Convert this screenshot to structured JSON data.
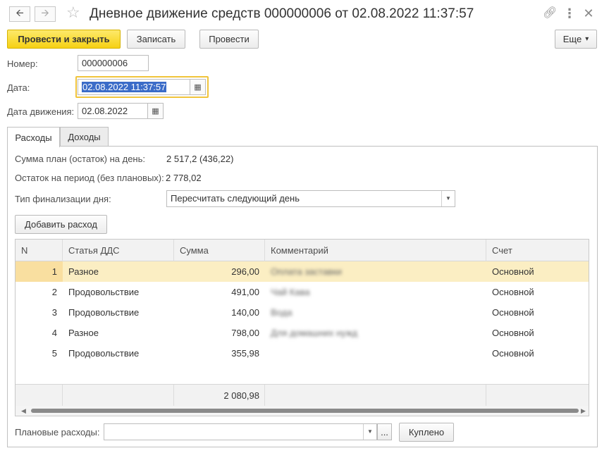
{
  "window": {
    "title": "Дневное движение средств 000000006 от 02.08.2022 11:37:57",
    "back_icon": "arrow-left-icon",
    "forward_icon": "arrow-right-icon",
    "favorite_icon": "star-icon",
    "link_icon": "link-icon",
    "menu_icon": "more-vertical-icon",
    "close_icon": "close-icon"
  },
  "toolbar": {
    "post_close": "Провести и закрыть",
    "save": "Записать",
    "post": "Провести",
    "more": "Еще",
    "more_arrow": "▾"
  },
  "form": {
    "number_label": "Номер:",
    "number_value": "000000006",
    "date_label": "Дата:",
    "date_value": "02.08.2022 11:37:57",
    "move_date_label": "Дата движения:",
    "move_date_value": "02.08.2022"
  },
  "tabs": [
    "Расходы",
    "Доходы"
  ],
  "summary": {
    "plan_label": "Сумма план (остаток) на день:",
    "plan_value": "2 517,2 (436,22)",
    "balance_label": "Остаток на период (без плановых):",
    "balance_value": "2 778,02",
    "finalization_label": "Тип финализации дня:",
    "finalization_value": "Пересчитать следующий день"
  },
  "add_expense_button": "Добавить расход",
  "table": {
    "columns": [
      "N",
      "Статья ДДС",
      "Сумма",
      "Комментарий",
      "Счет"
    ],
    "rows": [
      {
        "n": "1",
        "article": "Разное",
        "sum": "296,00",
        "comment": "Оплата заставки",
        "account": "Основной"
      },
      {
        "n": "2",
        "article": "Продовольствие",
        "sum": "491,00",
        "comment": "Чай Кава",
        "account": "Основной"
      },
      {
        "n": "3",
        "article": "Продовольствие",
        "sum": "140,00",
        "comment": "Вода",
        "account": "Основной"
      },
      {
        "n": "4",
        "article": "Разное",
        "sum": "798,00",
        "comment": "Для домашних нужд",
        "account": "Основной"
      },
      {
        "n": "5",
        "article": "Продовольствие",
        "sum": "355,98",
        "comment": "",
        "account": "Основной"
      }
    ],
    "total_sum": "2 080,98",
    "selected_row": 1
  },
  "planned": {
    "label": "Плановые расходы:",
    "value": "",
    "select_button": "...",
    "bought_button": "Куплено"
  },
  "colors": {
    "primary_button": "#f6d114",
    "selected_row": "#fbeec3",
    "focus_ring": "#f0c43c",
    "text_selection": "#3b6cc8"
  }
}
